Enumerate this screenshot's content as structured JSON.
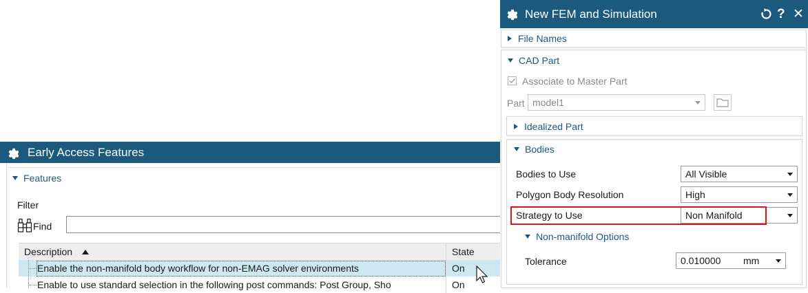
{
  "eaf": {
    "title": "Early Access Features",
    "features_header": "Features",
    "filter_label": "Filter",
    "find_label": "Find",
    "find_value": "",
    "col_description": "Description",
    "col_state": "State",
    "rows": [
      {
        "description": "Enable the non-manifold body workflow for non-EMAG solver environments",
        "state": "On"
      },
      {
        "description": "Enable to use standard selection in the following post commands: Post Group, Sho",
        "state": "On"
      }
    ]
  },
  "fem": {
    "title": "New FEM and Simulation",
    "file_names": "File Names",
    "cad_part": "CAD Part",
    "associate_label": "Associate to Master Part",
    "part_label": "Part",
    "part_value": "model1",
    "idealized_part": "Idealized Part",
    "bodies": "Bodies",
    "bodies_to_use_label": "Bodies to Use",
    "bodies_to_use_value": "All Visible",
    "polygon_res_label": "Polygon Body Resolution",
    "polygon_res_value": "High",
    "strategy_label": "Strategy to Use",
    "strategy_value": "Non Manifold",
    "nonmanifold_options": "Non-manifold Options",
    "tolerance_label": "Tolerance",
    "tolerance_value": "0.010000",
    "tolerance_unit": "mm"
  },
  "colors": {
    "title_bar": "#1c5a7d",
    "highlight_row": "#cde8f0",
    "red_outline": "#e0121b"
  }
}
